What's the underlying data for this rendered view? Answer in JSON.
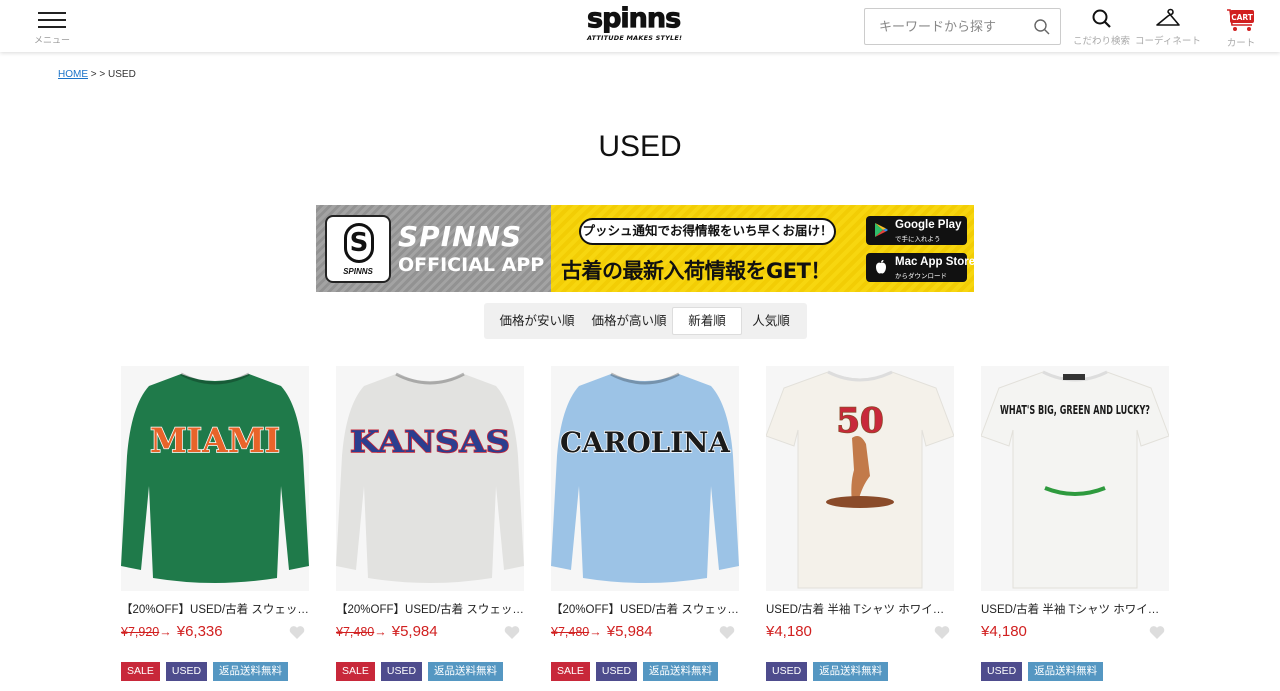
{
  "header": {
    "menu_label": "メニュー",
    "logo_word": "spinns",
    "logo_tagline": "ATTITUDE MAKES STYLE!",
    "search_placeholder": "キーワードから探す",
    "links": [
      {
        "label": "こだわり検索",
        "icon": "search-icon"
      },
      {
        "label": "コーディネート",
        "icon": "hanger-icon"
      },
      {
        "label": "カート",
        "icon": "cart-icon",
        "badge": "CART"
      }
    ]
  },
  "breadcrumb": {
    "home": "HOME",
    "separator": " > > ",
    "current": "USED"
  },
  "page_title": "USED",
  "banner": {
    "app_letter": "S",
    "app_name": "SPINNS",
    "brand_line1": "SPINNS",
    "brand_line2": "OFFICIAL APP",
    "bubble_text": "プッシュ通知でお得情報をいち早くお届け！",
    "headline": "古着の最新入荷情報をGET！",
    "google_play": {
      "line1": "Google Play",
      "line2": "で手に入れよう"
    },
    "app_store": {
      "line1": "Mac App Store",
      "line2": "からダウンロード"
    }
  },
  "sort_tabs": [
    {
      "label": "価格が安い順",
      "active": false
    },
    {
      "label": "価格が高い順",
      "active": false
    },
    {
      "label": "新着順",
      "active": true
    },
    {
      "label": "人気順",
      "active": false
    }
  ],
  "products": [
    {
      "name": "【20%OFF】USED/古着 スウェット…",
      "old_price": "¥7,920",
      "price": "¥6,336",
      "badges": [
        "SALE",
        "USED",
        "返品送料無料"
      ],
      "image_text": "MIAMI",
      "colors": {
        "garment": "#1f7a4a",
        "text": "#e8642a",
        "outline": "#ffffff"
      }
    },
    {
      "name": "【20%OFF】USED/古着 スウェット…",
      "old_price": "¥7,480",
      "price": "¥5,984",
      "badges": [
        "SALE",
        "USED",
        "返品送料無料"
      ],
      "image_text": "KANSAS",
      "colors": {
        "garment": "#e2e2e0",
        "text": "#2b3e8f",
        "outline": "#c8283a"
      }
    },
    {
      "name": "【20%OFF】USED/古着 スウェット…",
      "old_price": "¥7,480",
      "price": "¥5,984",
      "badges": [
        "SALE",
        "USED",
        "返品送料無料"
      ],
      "image_text": "CAROLINA",
      "colors": {
        "garment": "#9cc3e6",
        "text": "#1a1a1a",
        "outline": "#ffffff"
      }
    },
    {
      "name": "USED/古着 半袖 Tシャツ ホワイト…",
      "old_price": "",
      "price": "¥4,180",
      "badges": [
        "USED",
        "返品送料無料"
      ],
      "image_text": "50",
      "colors": {
        "garment": "#f4f1ea",
        "text": "#c8283a",
        "outline": "#8a4b2a"
      }
    },
    {
      "name": "USED/古着 半袖 Tシャツ ホワイト…",
      "old_price": "",
      "price": "¥4,180",
      "badges": [
        "USED",
        "返品送料無料"
      ],
      "image_text": "WHAT'S BIG, GREEN AND LUCKY?",
      "colors": {
        "garment": "#f4f4f2",
        "text": "#1a1a1a",
        "outline": "#2e9a3e"
      }
    }
  ],
  "colors": {
    "sale_red": "#d12020",
    "badge_sale": "#c8283a",
    "badge_used": "#4e4c8d",
    "badge_ship": "#5597c2"
  }
}
